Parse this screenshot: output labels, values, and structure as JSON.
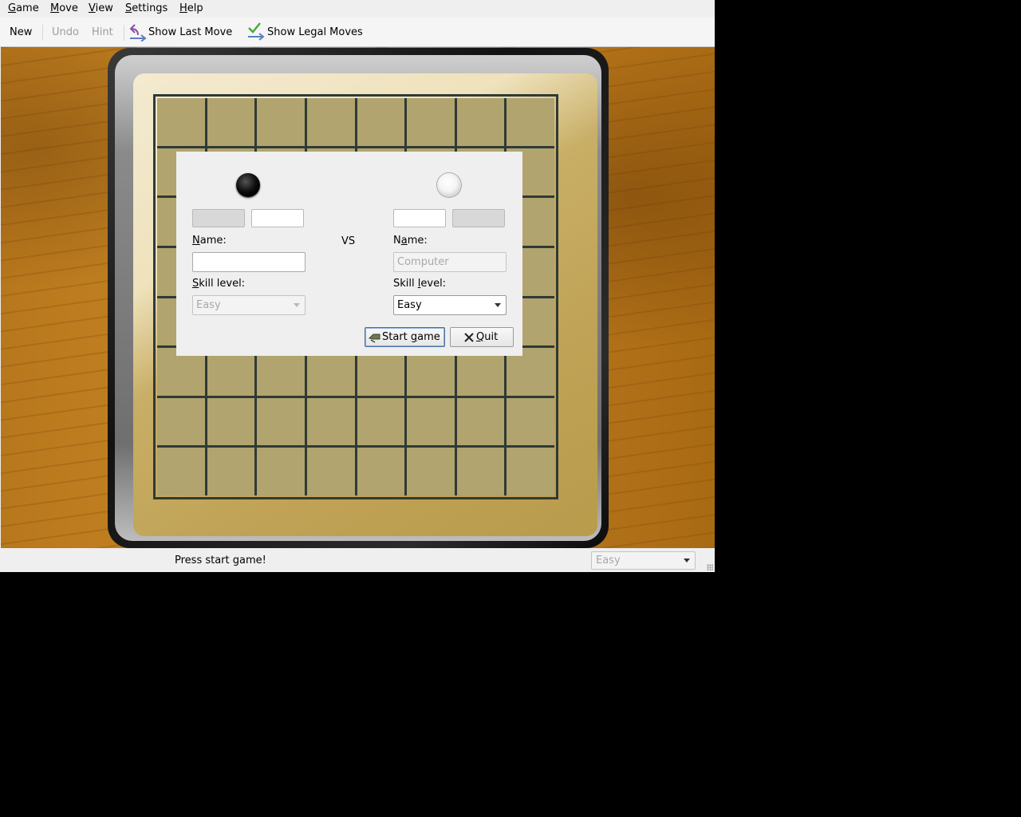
{
  "menubar": {
    "items": [
      {
        "label": "Game",
        "mnemonic": "G",
        "rest": "ame"
      },
      {
        "label": "Move",
        "mnemonic": "M",
        "rest": "ove"
      },
      {
        "label": "View",
        "mnemonic": "V",
        "rest": "iew"
      },
      {
        "label": "Settings",
        "mnemonic": "S",
        "rest": "ettings"
      },
      {
        "label": "Help",
        "mnemonic": "H",
        "rest": "elp"
      }
    ]
  },
  "toolbar": {
    "new_label": "New",
    "undo_label": "Undo",
    "hint_label": "Hint",
    "show_last_move_label": "Show Last Move",
    "show_legal_moves_label": "Show Legal Moves"
  },
  "dialog": {
    "vs_label": "VS",
    "player1": {
      "stone": "black",
      "name_label_mn": "N",
      "name_label_rest": "ame:",
      "name_value": "",
      "skill_label_mn": "S",
      "skill_label_rest": "kill level:",
      "skill_value": "Easy"
    },
    "player2": {
      "stone": "white",
      "name_label_pre": "N",
      "name_label_mn": "a",
      "name_label_rest": "me:",
      "name_placeholder": "Computer",
      "skill_label_pre": "Skill ",
      "skill_label_mn": "l",
      "skill_label_rest": "evel:",
      "skill_value": "Easy"
    },
    "start_button_pre": "Start ",
    "start_button_mn": "g",
    "start_button_rest": "ame",
    "quit_button_mn": "Q",
    "quit_button_rest": "uit"
  },
  "board": {
    "rows": 8,
    "cols": 8
  },
  "statusbar": {
    "message": "Press start game!",
    "difficulty_value": "Easy"
  },
  "colors": {
    "wood": "#c08025",
    "board_felt": "#d6bc6c",
    "grid_lines": "#2f3a36"
  }
}
